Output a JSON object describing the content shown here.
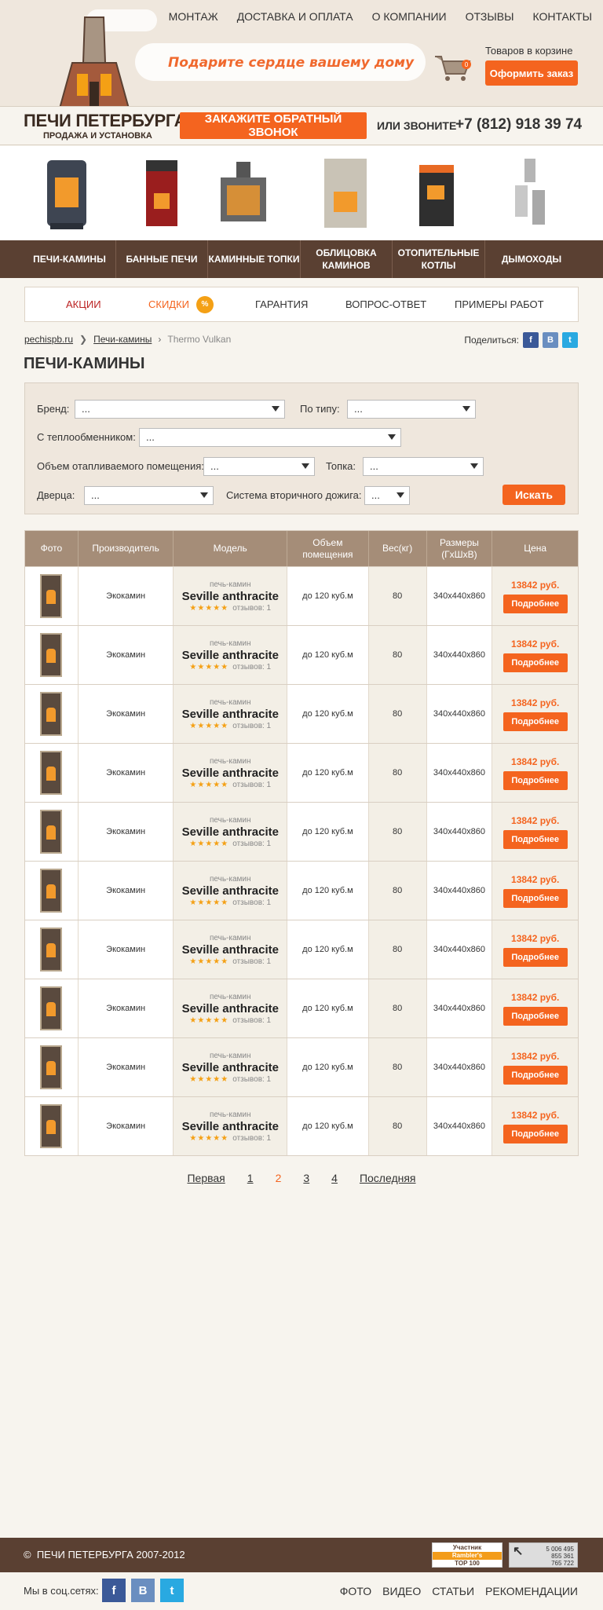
{
  "top_nav": [
    "МОНТАЖ",
    "ДОСТАВКА И ОПЛАТА",
    "О КОМПАНИИ",
    "ОТЗЫВЫ",
    "КОНТАКТЫ"
  ],
  "slogan": "Подарите сердце вашему дому",
  "cart": {
    "count": "0",
    "label": "Товаров в корзине",
    "order_label": "Оформить заказ"
  },
  "logo": {
    "title": "ПЕЧИ ПЕТЕРБУРГА",
    "subtitle": "ПРОДАЖА И УСТАНОВКА"
  },
  "callback_label": "ЗАКАЖИТЕ ОБРАТНЫЙ ЗВОНОК",
  "or_call": "ИЛИ ЗВОНИТЕ",
  "phone": "+7 (812) 918 39 74",
  "categories": [
    "ПЕЧИ-КАМИНЫ",
    "БАННЫЕ ПЕЧИ",
    "КАМИННЫЕ ТОПКИ",
    "ОБЛИЦОВКА КАМИНОВ",
    "ОТОПИТЕЛЬНЫЕ КОТЛЫ",
    "ДЫМОХОДЫ"
  ],
  "subnav": [
    "АКЦИИ",
    "СКИДКИ",
    "ГАРАНТИЯ",
    "ВОПРОС-ОТВЕТ",
    "ПРИМЕРЫ РАБОТ"
  ],
  "discount_badge": "%",
  "breadcrumb": [
    "pechispb.ru",
    "Печи-камины",
    "Thermo Vulkan"
  ],
  "share": {
    "label": "Поделиться:",
    "fb": "f",
    "vk": "B",
    "tw": "t"
  },
  "page_title": "ПЕЧИ-КАМИНЫ",
  "filter": {
    "brand_label": "Бренд:",
    "brand_value": "...",
    "type_label": "По типу:",
    "type_value": "...",
    "heat_label": "С теплообменником:",
    "heat_value": "...",
    "volume_label": "Объем отапливаемого помещения:",
    "volume_value": "...",
    "firebox_label": "Топка:",
    "firebox_value": "...",
    "door_label": "Дверца:",
    "door_value": "...",
    "afterburn_label": "Система вторичного дожига:",
    "afterburn_value": "...",
    "search_label": "Искать"
  },
  "table": {
    "headers": [
      "Фото",
      "Производитель",
      "Модель",
      "Объем помещения",
      "Вес(кг)",
      "Размеры (ГхШхВ)",
      "Цена"
    ],
    "rows": [
      {
        "maker": "Экокамин",
        "type": "печь-камин",
        "model": "Seville anthracite",
        "stars": "★★★★★",
        "reviews": "отзывов: 1",
        "volume": "до 120 куб.м",
        "weight": "80",
        "size": "340x440x860",
        "price": "13842 руб.",
        "btn": "Подробнее"
      },
      {
        "maker": "Экокамин",
        "type": "печь-камин",
        "model": "Seville anthracite",
        "stars": "★★★★★",
        "reviews": "отзывов: 1",
        "volume": "до 120 куб.м",
        "weight": "80",
        "size": "340x440x860",
        "price": "13842 руб.",
        "btn": "Подробнее"
      },
      {
        "maker": "Экокамин",
        "type": "печь-камин",
        "model": "Seville anthracite",
        "stars": "★★★★★",
        "reviews": "отзывов: 1",
        "volume": "до 120 куб.м",
        "weight": "80",
        "size": "340x440x860",
        "price": "13842 руб.",
        "btn": "Подробнее"
      },
      {
        "maker": "Экокамин",
        "type": "печь-камин",
        "model": "Seville anthracite",
        "stars": "★★★★★",
        "reviews": "отзывов: 1",
        "volume": "до 120 куб.м",
        "weight": "80",
        "size": "340x440x860",
        "price": "13842 руб.",
        "btn": "Подробнее"
      },
      {
        "maker": "Экокамин",
        "type": "печь-камин",
        "model": "Seville anthracite",
        "stars": "★★★★★",
        "reviews": "отзывов: 1",
        "volume": "до 120 куб.м",
        "weight": "80",
        "size": "340x440x860",
        "price": "13842 руб.",
        "btn": "Подробнее"
      },
      {
        "maker": "Экокамин",
        "type": "печь-камин",
        "model": "Seville anthracite",
        "stars": "★★★★★",
        "reviews": "отзывов: 1",
        "volume": "до 120 куб.м",
        "weight": "80",
        "size": "340x440x860",
        "price": "13842 руб.",
        "btn": "Подробнее"
      },
      {
        "maker": "Экокамин",
        "type": "печь-камин",
        "model": "Seville anthracite",
        "stars": "★★★★★",
        "reviews": "отзывов: 1",
        "volume": "до 120 куб.м",
        "weight": "80",
        "size": "340x440x860",
        "price": "13842 руб.",
        "btn": "Подробнее"
      },
      {
        "maker": "Экокамин",
        "type": "печь-камин",
        "model": "Seville anthracite",
        "stars": "★★★★★",
        "reviews": "отзывов: 1",
        "volume": "до 120 куб.м",
        "weight": "80",
        "size": "340x440x860",
        "price": "13842 руб.",
        "btn": "Подробнее"
      },
      {
        "maker": "Экокамин",
        "type": "печь-камин",
        "model": "Seville anthracite",
        "stars": "★★★★★",
        "reviews": "отзывов: 1",
        "volume": "до 120 куб.м",
        "weight": "80",
        "size": "340x440x860",
        "price": "13842 руб.",
        "btn": "Подробнее"
      },
      {
        "maker": "Экокамин",
        "type": "печь-камин",
        "model": "Seville anthracite",
        "stars": "★★★★★",
        "reviews": "отзывов: 1",
        "volume": "до 120 куб.м",
        "weight": "80",
        "size": "340x440x860",
        "price": "13842 руб.",
        "btn": "Подробнее"
      }
    ]
  },
  "pager": {
    "first": "Первая",
    "pages": [
      "1",
      "2",
      "3",
      "4"
    ],
    "current": "2",
    "last": "Последняя"
  },
  "footer": {
    "copyright": "ПЕЧИ ПЕТЕРБУРГА 2007-2012",
    "copy_sign": "©",
    "rambler": [
      "Участник",
      "Rambler's",
      "TOP 100"
    ],
    "counter": [
      "5 006 495",
      "855 361",
      "765 722"
    ]
  },
  "social": {
    "label": "Мы в соц.сетях:",
    "fb": "f",
    "vk": "B",
    "tw": "t"
  },
  "bottom_nav": [
    "ФОТО",
    "ВИДЕО",
    "СТАТЬИ",
    "РЕКОМЕНДАЦИИ"
  ],
  "colors": {
    "accent": "#f4641f",
    "brown": "#5a4032",
    "table_head": "#a58d78"
  }
}
